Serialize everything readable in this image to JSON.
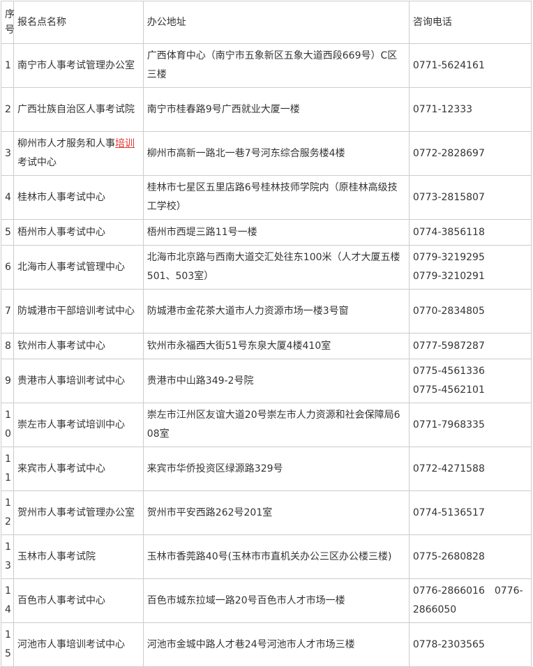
{
  "header": {
    "num": "序号",
    "name": "报名点名称",
    "address": "办公地址",
    "phone": "咨询电话"
  },
  "rows": [
    {
      "num": "1",
      "name": "南宁市人事考试管理办公室",
      "address": "广西体育中心（南宁市五象新区五象大道西段669号）C区三楼",
      "phones": [
        "0771-5624161"
      ]
    },
    {
      "num": "2",
      "name": "广西壮族自治区人事考试院",
      "address": "南宁市桂春路9号广西就业大厦一楼",
      "phones": [
        "0771-12333"
      ]
    },
    {
      "num": "3",
      "name_prefix": "柳州市人才服务和人事",
      "name_link": "培训",
      "name_suffix": "考试中心",
      "address": "柳州市高新一路北一巷7号河东综合服务楼4楼",
      "phones": [
        "0772-2828697"
      ]
    },
    {
      "num": "4",
      "name": "桂林市人事考试中心",
      "address": "桂林市七星区五里店路6号桂林技师学院内（原桂林高级技工学校）",
      "phones": [
        "0773-2815807"
      ]
    },
    {
      "num": "5",
      "name": "梧州市人事考试中心",
      "address": "梧州市西堤三路11号一楼",
      "phones": [
        "0774-3856118"
      ]
    },
    {
      "num": "6",
      "name": "北海市人事考试管理中心",
      "address": "北海市北京路与西南大道交汇处往东100米（人才大厦五楼501、503室）",
      "phones": [
        "0779-3219295",
        "0779-3210291"
      ]
    },
    {
      "num": "7",
      "name": "防城港市干部培训考试中心",
      "address": "防城港市金花茶大道市人力资源市场一楼3号窗",
      "phones": [
        "0770-2834805"
      ]
    },
    {
      "num": "8",
      "name": "钦州市人事考试中心",
      "address": "钦州市永福西大街51号东泉大厦4楼410室",
      "phones": [
        "0777-5987287"
      ]
    },
    {
      "num": "9",
      "name": "贵港市人事培训考试中心",
      "address": "贵港市中山路349-2号院",
      "phones": [
        "0775-4561336",
        "0775-4562101"
      ]
    },
    {
      "num": "10",
      "name": "崇左市人事考试培训中心",
      "address": "崇左市江州区友谊大道20号崇左市人力资源和社会保障局608室",
      "phones": [
        "0771-7968335"
      ]
    },
    {
      "num": "11",
      "name": "来宾市人事考试中心",
      "address": "来宾市华侨投资区绿源路329号",
      "phones": [
        "0772-4271588"
      ]
    },
    {
      "num": "12",
      "name": "贺州市人事考试管理办公室",
      "address": "贺州市平安西路262号201室",
      "phones": [
        "0774-5136517"
      ]
    },
    {
      "num": "13",
      "name": "玉林市人事考试院",
      "address": "玉林市香莞路40号(玉林市市直机关办公三区办公楼三楼)",
      "phones": [
        "0775-2680828"
      ]
    },
    {
      "num": "14",
      "name": "百色市人事考试中心",
      "address": "百色市城东拉域一路20号百色市人才市场一楼",
      "phones": [
        "0776-2866016　0776-2866050"
      ]
    },
    {
      "num": "15",
      "name": "河池市人事培训考试中心",
      "address": "河池市金城中路人才巷24号河池市人才市场三楼",
      "phones": [
        "0778-2303565"
      ]
    }
  ],
  "colors": {
    "border": "#cccccc",
    "text": "#333333",
    "link_underline": "#e5332a"
  }
}
